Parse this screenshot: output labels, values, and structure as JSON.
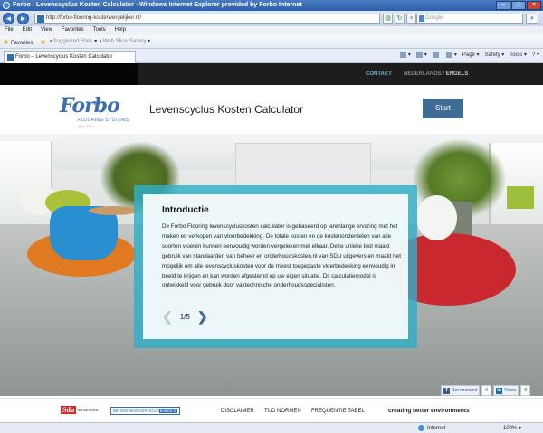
{
  "browser": {
    "window_title": "Forbo - Levenscyclus Kosten Calculator - Windows Internet Explorer provided by Forbo Internet",
    "address_url": "http://forbo-flooring-kostenvergelijker.nl/",
    "search_placeholder": "Google",
    "menu": [
      "File",
      "Edit",
      "View",
      "Favorites",
      "Tools",
      "Help"
    ],
    "favorites_label": "Favorites",
    "suggested_sites": "Suggested Sites",
    "web_slice_gallery": "Web Slice Gallery",
    "tab_title": "Forbo – Levenscyclus Kosten Calculator",
    "tools": [
      "Page",
      "Safety",
      "Tools"
    ],
    "status_zone": "Internet",
    "zoom_level": "100%"
  },
  "site": {
    "top_nav": {
      "contact": "CONTACT",
      "lang_nl": "NEDERLANDS",
      "lang_sep": " / ",
      "lang_en": "ENGELS"
    },
    "logo": {
      "brand": "Forbo",
      "subtitle": "FLOORING SYSTEMS",
      "date": "april 2013"
    },
    "title": "Levenscyclus Kosten Calculator",
    "start_button": "Start",
    "intro": {
      "title": "Introductie",
      "text": "De Forbo Flooring levenscycluskosten calculator is gebaseerd op jarenlange ervaring met het maken en verkopen van vloerbedekking. De totale kosten en de kostenonderdelen van alle soorten vloeren kunnen eenvoudig worden vergeleken met elkaar. Deze unieke tool maakt gebruik van standaarden van beheer en onderhoudskosten.nl van SDU uitgevers en maakt het mogelijk om alle levenscycluskosten voor de meest toegepaste vloerbedekking eenvoudig in beeld te krijgen en kan worden afgestemd op uw eigen situatie. Dit calculatiemodel is ontwikkeld voor gebruik door vaktechnische onderhoudsspecialisten.",
      "page": "1/5"
    },
    "social": {
      "facebook_label": "Recommend",
      "facebook_count": "0",
      "linkedin_label": "Share",
      "linkedin_count": "6"
    },
    "footer": {
      "sdu_logo": "Sdu",
      "sdu_small": "UITGEVERS",
      "beheer_logo_a": "BEHEER",
      "beheer_logo_b": "&ONDERHOUD",
      "beheer_logo_c": "kosten.nl",
      "links": [
        "DISCLAIMER",
        "TUD NORMEN",
        "FREQUENTIE TABEL"
      ],
      "tagline": "creating better environments"
    }
  }
}
